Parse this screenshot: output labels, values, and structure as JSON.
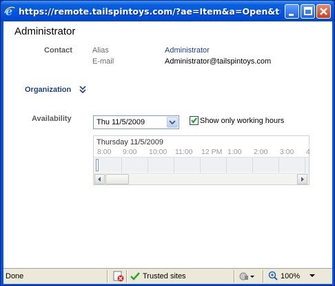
{
  "window": {
    "title": "https://remote.tailspintoys.com/?ae=Item&a=Open&t=AD.R...",
    "icon": "ie-icon"
  },
  "page": {
    "heading": "Administrator"
  },
  "contact": {
    "label": "Contact",
    "alias_label": "Alias",
    "alias_value": "Administrator",
    "email_label": "E-mail",
    "email_value": "Administrator@tailspintoys.com"
  },
  "organization": {
    "label": "Organization",
    "icon": "double-chevron-down-icon"
  },
  "availability": {
    "label": "Availability",
    "date_selected": "Thu 11/5/2009",
    "working_hours_label": "Show only working hours",
    "working_hours_checked": true,
    "grid_date": "Thursday 11/5/2009",
    "hours": [
      "8:00",
      "9:00",
      "10:00",
      "11:00",
      "12 PM",
      "1:00",
      "2:00",
      "3:00",
      "4"
    ]
  },
  "statusbar": {
    "status_text": "Done",
    "zone_text": "Trusted sites",
    "zoom_text": "100%"
  }
}
